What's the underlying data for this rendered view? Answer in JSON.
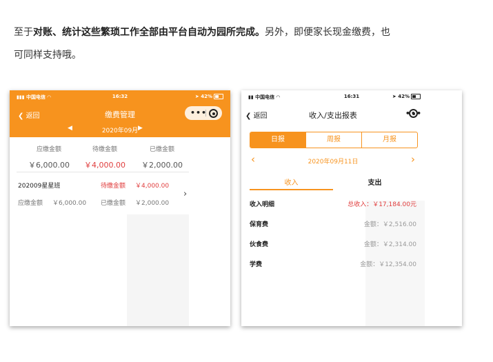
{
  "intro": {
    "line1_pre": "至于",
    "line1_bold": "对账、统计这些繁琐工作全部由平台自动为园所完成。",
    "line1_post": "另外，即便家长现金缴费，也",
    "line2": "可同样支持哦。"
  },
  "left_phone": {
    "status": {
      "carrier": "中国电信",
      "time": "16:32",
      "battery": "42%"
    },
    "back_label": "返回",
    "title": "缴费管理",
    "capsule_dots": "•••",
    "month": "2020年09月",
    "prev_arrow": "◀",
    "next_arrow": "▶",
    "summary": [
      {
        "label": "应缴金额",
        "value": "￥6,000.00"
      },
      {
        "label": "待缴金额",
        "value": "￥4,000.00"
      },
      {
        "label": "已缴金额",
        "value": "￥2,000.00"
      }
    ],
    "class_row": {
      "name": "202009星星班",
      "due_label": "待缴金额",
      "due_value": "￥4,000.00",
      "payable_label": "应缴金额",
      "payable_value": "￥6,000.00",
      "paid_label": "已缴金额",
      "paid_value": "￥2,000.00",
      "chevron": "›"
    }
  },
  "right_phone": {
    "status": {
      "carrier": "中国电信",
      "time": "16:31",
      "battery": "42%"
    },
    "back_label": "返回",
    "title": "收入/支出报表",
    "capsule_dots": "•••",
    "segments": [
      "日报",
      "周报",
      "月报"
    ],
    "date": "2020年09月11日",
    "prev_arrow": "‹",
    "next_arrow": "›",
    "tabs": {
      "income": "收入",
      "expense": "支出"
    },
    "detail": {
      "label": "收入明细",
      "total": "总收入：￥17,184.00元"
    },
    "rows": [
      {
        "label": "保育费",
        "amount": "金额：￥2,516.00"
      },
      {
        "label": "伙食费",
        "amount": "金额：￥2,314.00"
      },
      {
        "label": "学费",
        "amount": "金额：￥12,354.00"
      }
    ]
  },
  "colors": {
    "accent": "#f7931e",
    "alert": "#e03d3d"
  }
}
